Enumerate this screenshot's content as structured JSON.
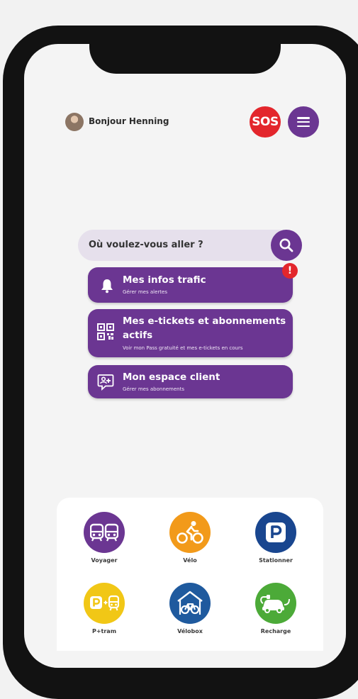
{
  "header": {
    "greeting": "Bonjour Henning",
    "sos_label": "SOS"
  },
  "search": {
    "placeholder": "Où voulez-vous aller ?"
  },
  "cards": [
    {
      "title": "Mes infos trafic",
      "subtitle": "Gérer mes alertes",
      "icon": "bell-icon"
    },
    {
      "title_line1": "Mes e-tickets et abonnements",
      "title_line2": "actifs",
      "subtitle": "Voir mon Pass gratuité et mes e-tickets en cours",
      "icon": "qr-code-icon"
    },
    {
      "title": "Mon espace client",
      "subtitle": "Gérer mes abonnements",
      "icon": "user-chat-icon"
    }
  ],
  "alert_badge": "!",
  "services": [
    {
      "label": "Voyager",
      "icon": "bus-tram-icon",
      "color": "#6b3692"
    },
    {
      "label": "Vélo",
      "icon": "bike-icon",
      "color": "#f29a1a"
    },
    {
      "label": "Stationner",
      "icon": "parking-icon",
      "color": "#19468f"
    },
    {
      "label": "P+tram",
      "icon": "park-and-ride-icon",
      "color": "#f1c716"
    },
    {
      "label": "Vélobox",
      "icon": "bike-shelter-icon",
      "color": "#1f5a9e"
    },
    {
      "label": "Recharge",
      "icon": "ev-charge-icon",
      "color": "#4caa38"
    }
  ],
  "colors": {
    "brand_purple": "#6b3692",
    "sos_red": "#e3262c",
    "search_bg": "#e6e0ec"
  }
}
